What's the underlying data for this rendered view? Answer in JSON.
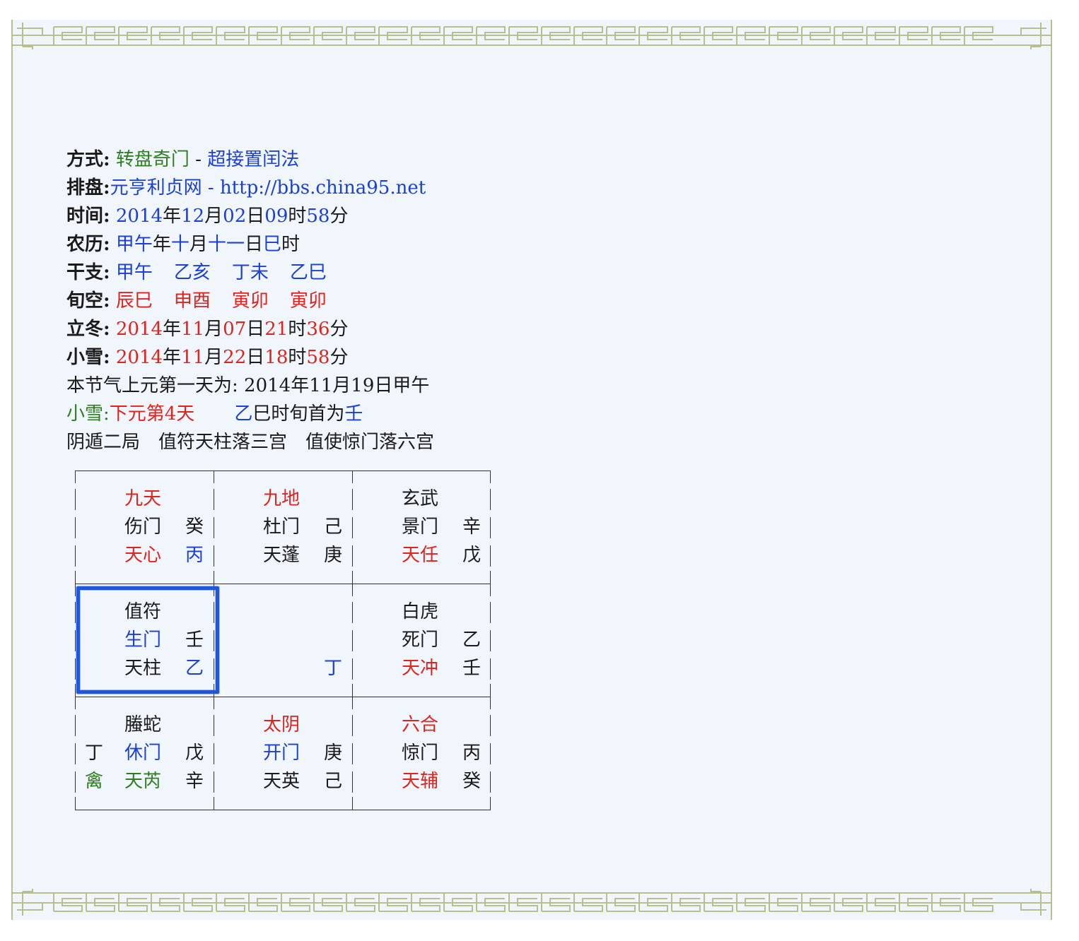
{
  "header": {
    "method_label": "方式:",
    "method_a": "转盘奇门",
    "method_sep": " - ",
    "method_b": "超接置闰法",
    "layout_label": "排盘:",
    "layout_site": "元亨利贞网",
    "layout_url": " - http://bbs.china95.net"
  },
  "time": {
    "label": "时间:",
    "year": "2014",
    "year_u": "年",
    "month": "12",
    "month_u": "月",
    "day": "02",
    "day_u": "日",
    "hour": "09",
    "hour_u": "时",
    "minute": "58",
    "minute_u": "分"
  },
  "lunar": {
    "label": "农历:",
    "year": "甲午",
    "year_u": "年",
    "month": "十",
    "month_u": "月",
    "day": "十一",
    "day_u": "日",
    "hour": "巳",
    "hour_u": "时"
  },
  "ganzhi": {
    "label": "干支:",
    "items": [
      "甲午",
      "乙亥",
      "丁未",
      "乙巳"
    ]
  },
  "xunkong": {
    "label": "旬空:",
    "items": [
      "辰巳",
      "申酉",
      "寅卯",
      "寅卯"
    ]
  },
  "lidong": {
    "label": "立冬:",
    "year": "2014",
    "month": "11",
    "day": "07",
    "hour": "21",
    "minute": "36",
    "u_year": "年",
    "u_month": "月",
    "u_day": "日",
    "u_hour": "时",
    "u_minute": "分"
  },
  "xiaoxue": {
    "label": "小雪:",
    "year": "2014",
    "month": "11",
    "day": "22",
    "hour": "18",
    "minute": "58",
    "u_year": "年",
    "u_month": "月",
    "u_day": "日",
    "u_hour": "时",
    "u_minute": "分"
  },
  "first_day": "本节气上元第一天为: 2014年11月19日甲午",
  "yuan": {
    "label": "小雪:",
    "stage": "下元第4天",
    "xun_a": "乙",
    "xun_b": "巳时旬首为",
    "xun_c": "壬"
  },
  "ju": "阴遁二局　值符天柱落三宫　值使惊门落六宫",
  "palaces": [
    {
      "god": "九天",
      "door": "伤门",
      "door_gan": "癸",
      "star": "天心",
      "star_gan": "丙",
      "side_top": "",
      "side_bot": ""
    },
    {
      "god": "九地",
      "door": "杜门",
      "door_gan": "己",
      "star": "天蓬",
      "star_gan": "庚",
      "side_top": "",
      "side_bot": ""
    },
    {
      "god": "玄武",
      "door": "景门",
      "door_gan": "辛",
      "star": "天任",
      "star_gan": "戊",
      "side_top": "",
      "side_bot": ""
    },
    {
      "god": "值符",
      "door": "生门",
      "door_gan": "壬",
      "star": "天柱",
      "star_gan": "乙",
      "side_top": "",
      "side_bot": ""
    },
    {
      "god": "",
      "door": "",
      "door_gan": "",
      "star": "",
      "star_gan": "丁",
      "side_top": "",
      "side_bot": ""
    },
    {
      "god": "白虎",
      "door": "死门",
      "door_gan": "乙",
      "star": "天冲",
      "star_gan": "壬",
      "side_top": "",
      "side_bot": ""
    },
    {
      "god": "螣蛇",
      "door": "休门",
      "door_gan": "戊",
      "star": "天芮",
      "star_gan": "辛",
      "side_top": "丁",
      "side_bot": "禽"
    },
    {
      "god": "太阴",
      "door": "开门",
      "door_gan": "庚",
      "star": "天英",
      "star_gan": "己",
      "side_top": "",
      "side_bot": ""
    },
    {
      "god": "六合",
      "door": "惊门",
      "door_gan": "丙",
      "star": "天辅",
      "star_gan": "癸",
      "side_top": "",
      "side_bot": ""
    }
  ],
  "colors": {
    "green": "#2e7d1f",
    "blue": "#1a3fd6",
    "red": "#e0231d",
    "highlight_border": "#1f56e0",
    "frame_border": "#b7bf8c",
    "background": "#f1f6fc"
  }
}
